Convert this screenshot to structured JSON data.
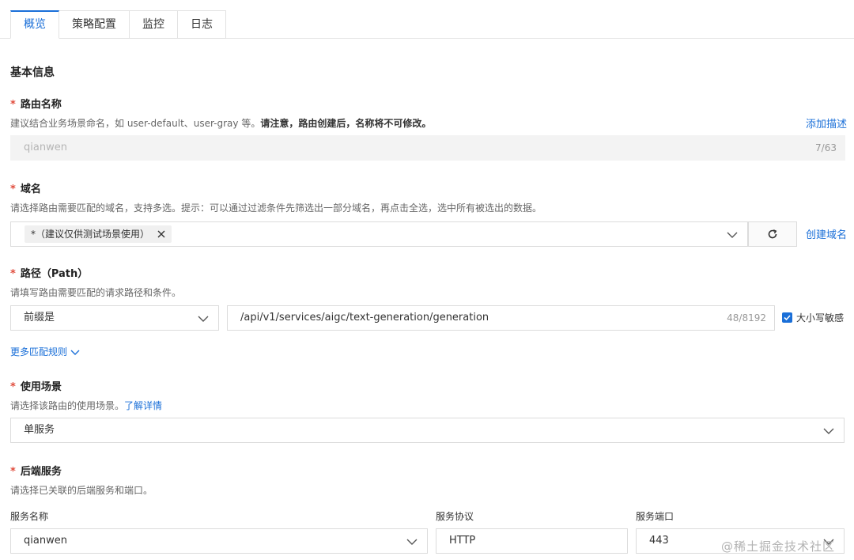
{
  "tabs": [
    {
      "label": "概览",
      "active": true
    },
    {
      "label": "策略配置",
      "active": false
    },
    {
      "label": "监控",
      "active": false
    },
    {
      "label": "日志",
      "active": false
    }
  ],
  "basic_info": {
    "title": "基本信息"
  },
  "route_name": {
    "required_mark": "*",
    "label": "路由名称",
    "hint_plain": "建议结合业务场景命名，如 user-default、user-gray 等。",
    "hint_bold": "请注意，路由创建后，名称将不可修改。",
    "add_desc_link": "添加描述",
    "value": "qianwen",
    "counter": "7/63"
  },
  "domain": {
    "required_mark": "*",
    "label": "域名",
    "hint": "请选择路由需要匹配的域名，支持多选。提示：可以通过过滤条件先筛选出一部分域名，再点击全选，选中所有被选出的数据。",
    "tag": "*（建议仅供测试场景使用）",
    "create_link": "创建域名"
  },
  "path": {
    "required_mark": "*",
    "label": "路径（Path）",
    "hint": "请填写路由需要匹配的请求路径和条件。",
    "match_type": "前缀是",
    "value": "/api/v1/services/aigc/text-generation/generation",
    "counter": "48/8192",
    "case_sensitive_label": "大小写敏感",
    "case_sensitive_checked": true,
    "more_rules": "更多匹配规则"
  },
  "scenario": {
    "required_mark": "*",
    "label": "使用场景",
    "hint": "请选择该路由的使用场景。",
    "hint_link": "了解详情",
    "value": "单服务"
  },
  "backend": {
    "required_mark": "*",
    "label": "后端服务",
    "hint": "请选择已关联的后端服务和端口。",
    "service_name_label": "服务名称",
    "service_name_value": "qianwen",
    "protocol_label": "服务协议",
    "protocol_value": "HTTP",
    "port_label": "服务端口",
    "port_value": "443"
  },
  "watermark": "@稀土掘金技术社区",
  "colors": {
    "accent": "#1a6fd8",
    "required": "#e04a3a"
  }
}
